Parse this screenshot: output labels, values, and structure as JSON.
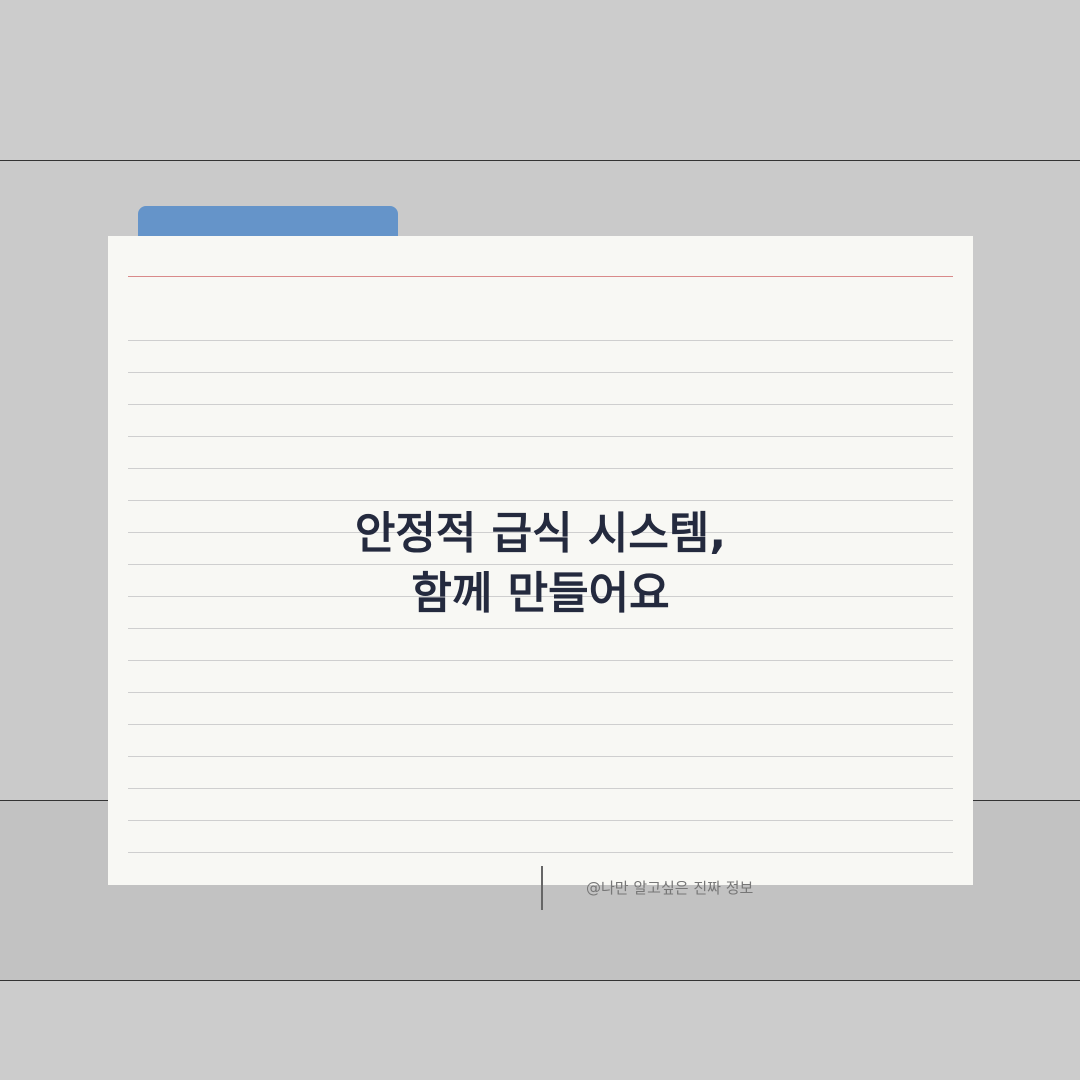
{
  "card": {
    "headline_line1": "안정적 급식 시스템,",
    "headline_line2": "함께 만들어요"
  },
  "footer": {
    "credit": "@나만 알고싶은 진짜 정보"
  },
  "colors": {
    "tab_accent": "#6594c9",
    "headline_text": "#242a3e",
    "margin_rule": "#d98a8a",
    "card_background": "#f8f8f4",
    "page_background": "#cccccc"
  }
}
